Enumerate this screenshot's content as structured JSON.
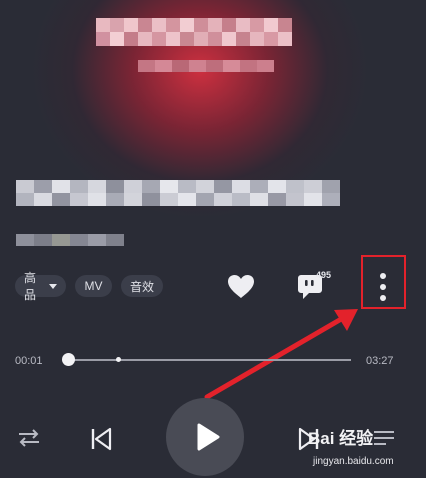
{
  "controls": {
    "quality_label": "高品",
    "mv_label": "MV",
    "effect_label": "音效",
    "comment_count": "495"
  },
  "progress": {
    "elapsed": "00:01",
    "duration": "03:27",
    "played_fraction": 0.0,
    "buffered_fraction": 0.17
  },
  "watermark": {
    "brand": "Bai 经验",
    "url": "jingyan.baidu.com"
  },
  "colors": {
    "background": "#2a2c36",
    "glow": "#d63040",
    "highlight_box": "#e3222b",
    "arrow": "#e3222b"
  },
  "icons": {
    "like": "heart-icon",
    "comments": "comment-icon",
    "more": "more-vertical-icon",
    "mode": "repeat-icon",
    "prev": "skip-back-icon",
    "play": "play-icon",
    "next": "skip-forward-icon",
    "playlist": "playlist-icon"
  }
}
